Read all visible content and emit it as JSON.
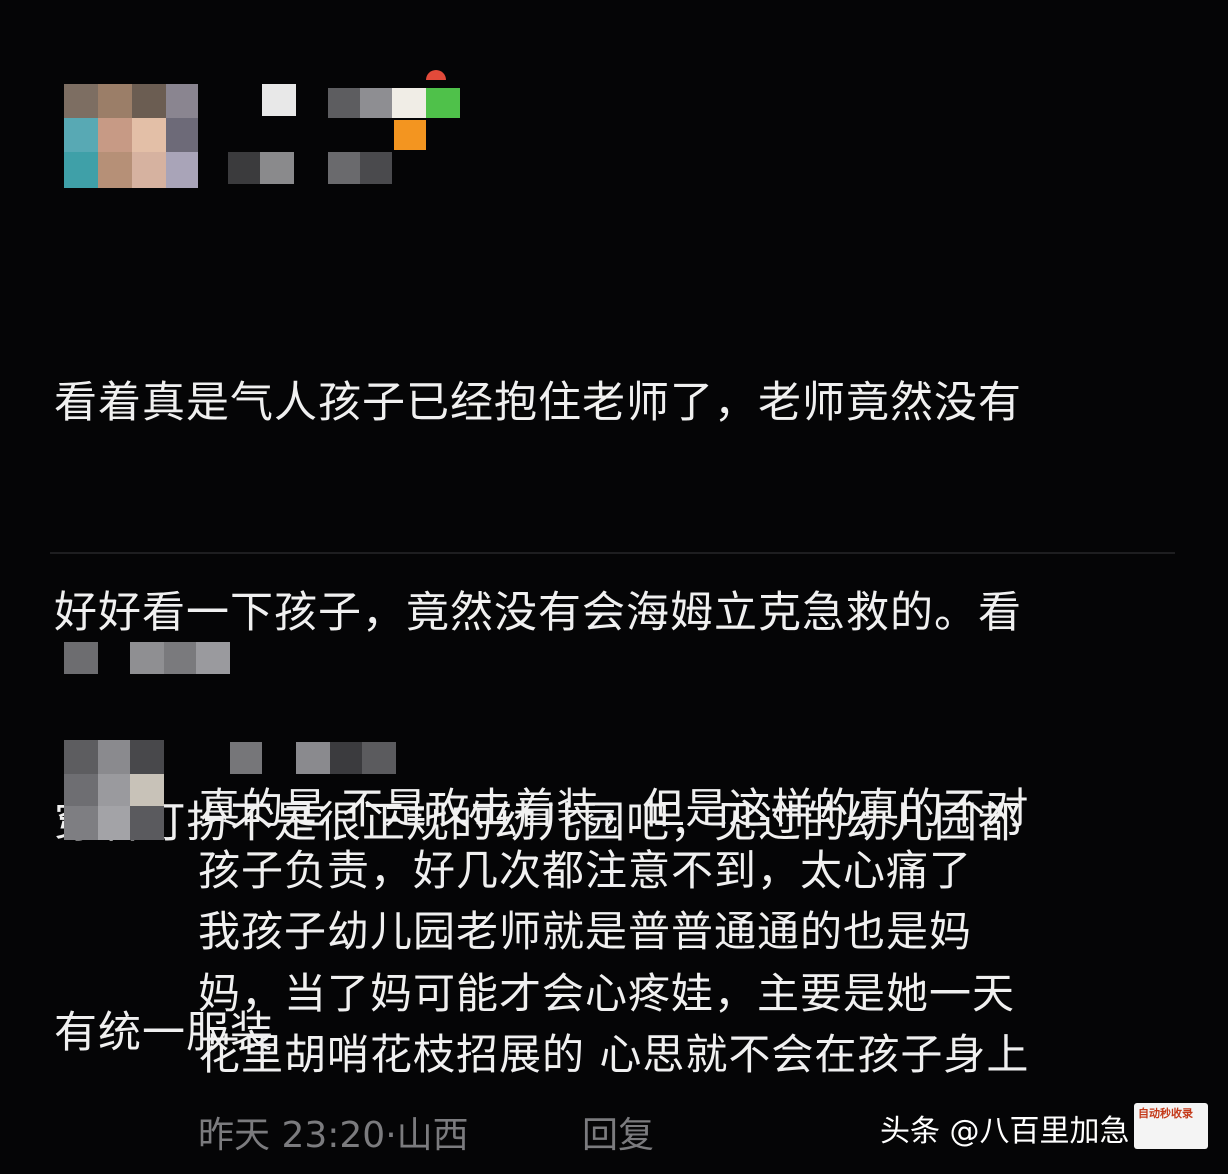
{
  "comment1": {
    "text_lines": [
      "看着真是气人孩子已经抱住老师了，老师竟然没有",
      "好好看一下孩子，竟然没有会海姆立克急救的。看",
      "穿着打扮不是很正规的幼儿园吧，见过的幼儿园都",
      "有统一服装"
    ]
  },
  "reply": {
    "text_lines": [
      "真的是 不是攻击着装，但是这样的真的不对",
      "孩子负责，好几次都注意不到，太心痛了",
      "我孩子幼儿园老师就是普普通通的也是妈",
      "妈，当了妈可能才会心疼娃，主要是她一天",
      "花里胡哨花枝招展的 心思就不会在孩子身上"
    ],
    "time": "昨天 23:20",
    "separator": "·",
    "location": "山西",
    "reply_label": "回复"
  },
  "watermark": {
    "text": "头条 @八百里加急",
    "logo_text": "自动秒收录"
  },
  "colors": {
    "background": "#050506",
    "text": "#f0f0f0",
    "meta": "#7b7b7e",
    "divider": "#1e1e20"
  }
}
